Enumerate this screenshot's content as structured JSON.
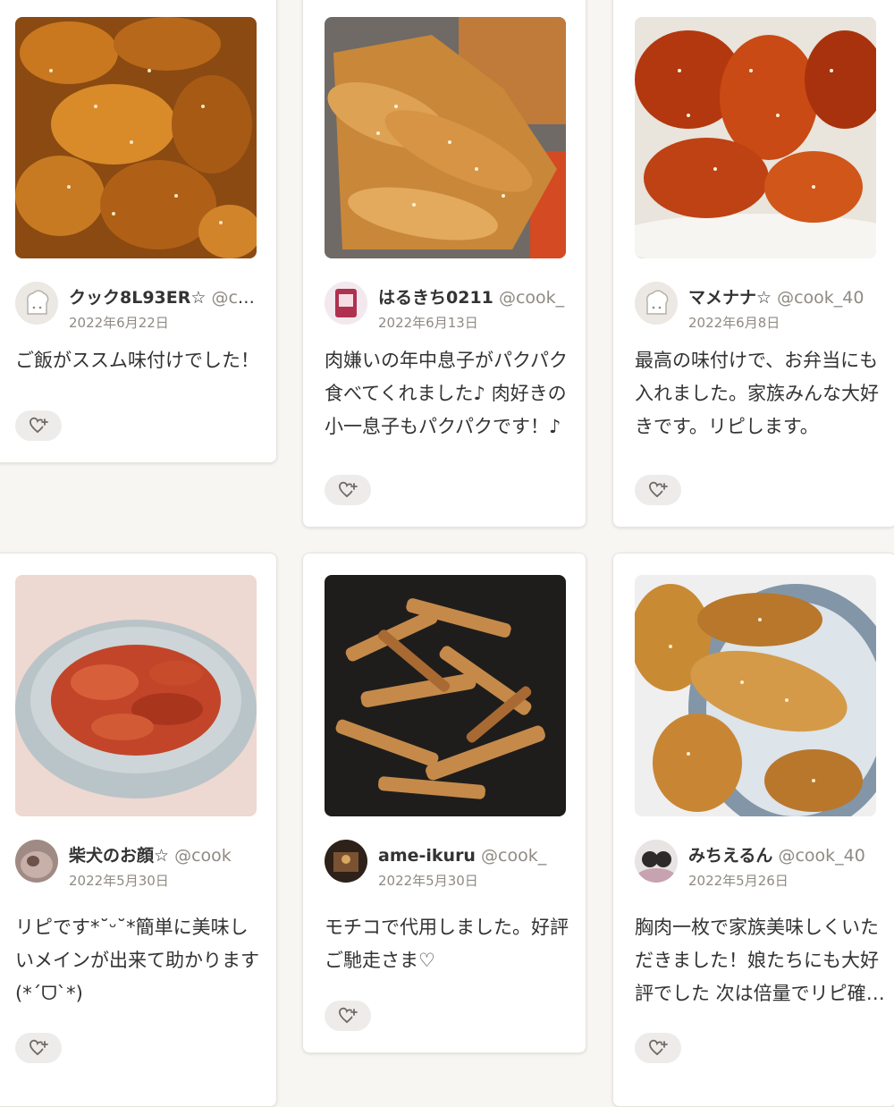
{
  "cards": [
    {
      "username": "クック8L93ER☆",
      "handle": "@cook_",
      "date": "2022年6月22日",
      "comment": "ご飯がススム味付けでした！",
      "photo_icon": "fried-chicken-sesame-photo",
      "avatar_icon": "default-chef-avatar-icon"
    },
    {
      "username": "はるきち0211",
      "handle": "@cook_",
      "date": "2022年6月13日",
      "comment": "肉嫌いの年中息子がパクパク食べてくれました♪ 肉好きの小一息子もパクパクです！♪",
      "photo_icon": "glazed-chicken-strips-photo",
      "avatar_icon": "user-photo-avatar-icon"
    },
    {
      "username": "マメナナ☆",
      "handle": "@cook_40",
      "date": "2022年6月8日",
      "comment": "最高の味付けで、お弁当にも入れました。家族みんな大好きです。リピします。",
      "photo_icon": "sweet-chili-chicken-photo",
      "avatar_icon": "default-chef-avatar-icon"
    },
    {
      "username": "柴犬のお顔☆",
      "handle": "@cook",
      "date": "2022年5月30日",
      "comment": "リピです*˘ᵕ˘*簡単に美味しいメインが出来て助かります(*´ᗜ`*)",
      "photo_icon": "chicken-in-bowl-photo",
      "avatar_icon": "user-photo-avatar-icon"
    },
    {
      "username": "ame-ikuru",
      "handle": "@cook_",
      "date": "2022年5月30日",
      "comment": "モチコで代用しました。好評ご馳走さま♡",
      "photo_icon": "chicken-in-pan-photo",
      "avatar_icon": "user-photo-avatar-icon"
    },
    {
      "username": "みちえるん",
      "handle": "@cook_40",
      "date": "2022年5月26日",
      "comment": "胸肉一枚で家族美味しくいただきました！娘たちにも大好評でした 次は倍量でリピ確定です",
      "photo_icon": "fried-chicken-plate-photo",
      "avatar_icon": "user-photo-avatar-icon"
    }
  ],
  "colors": {
    "accent": "#e8e5df",
    "background": "#f8f6f2",
    "card": "#ffffff",
    "muted_text": "#8f8a83"
  }
}
